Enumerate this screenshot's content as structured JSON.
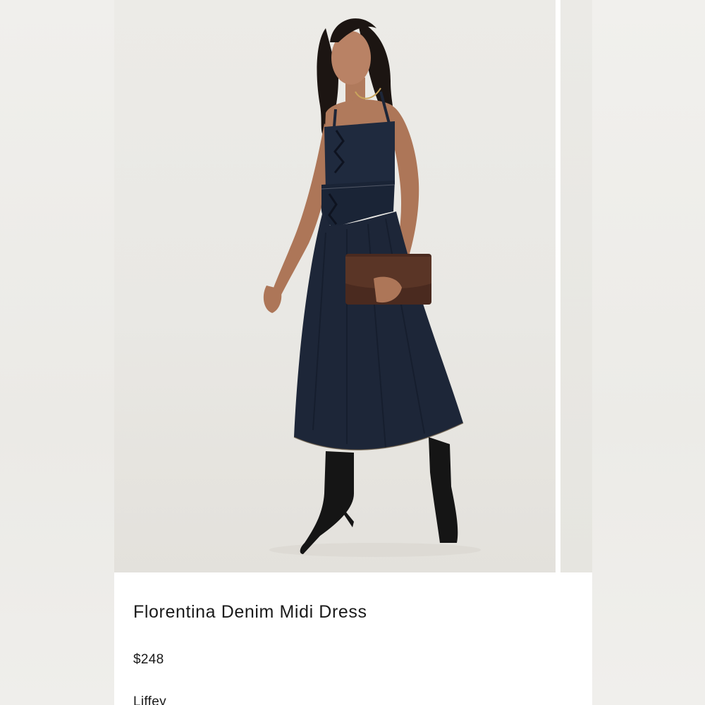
{
  "product": {
    "name": "Florentina Denim Midi Dress",
    "price": "$248",
    "color": "Liffey"
  },
  "gallery": {
    "main_image": "model-in-denim-midi-dress-photo",
    "next_image": "next-product-photo-peek"
  },
  "colors": {
    "background": "#ffffff",
    "text": "#1a1a1a",
    "denim": "#1d2638",
    "boots": "#141414",
    "clutch": "#4a2a1f"
  }
}
